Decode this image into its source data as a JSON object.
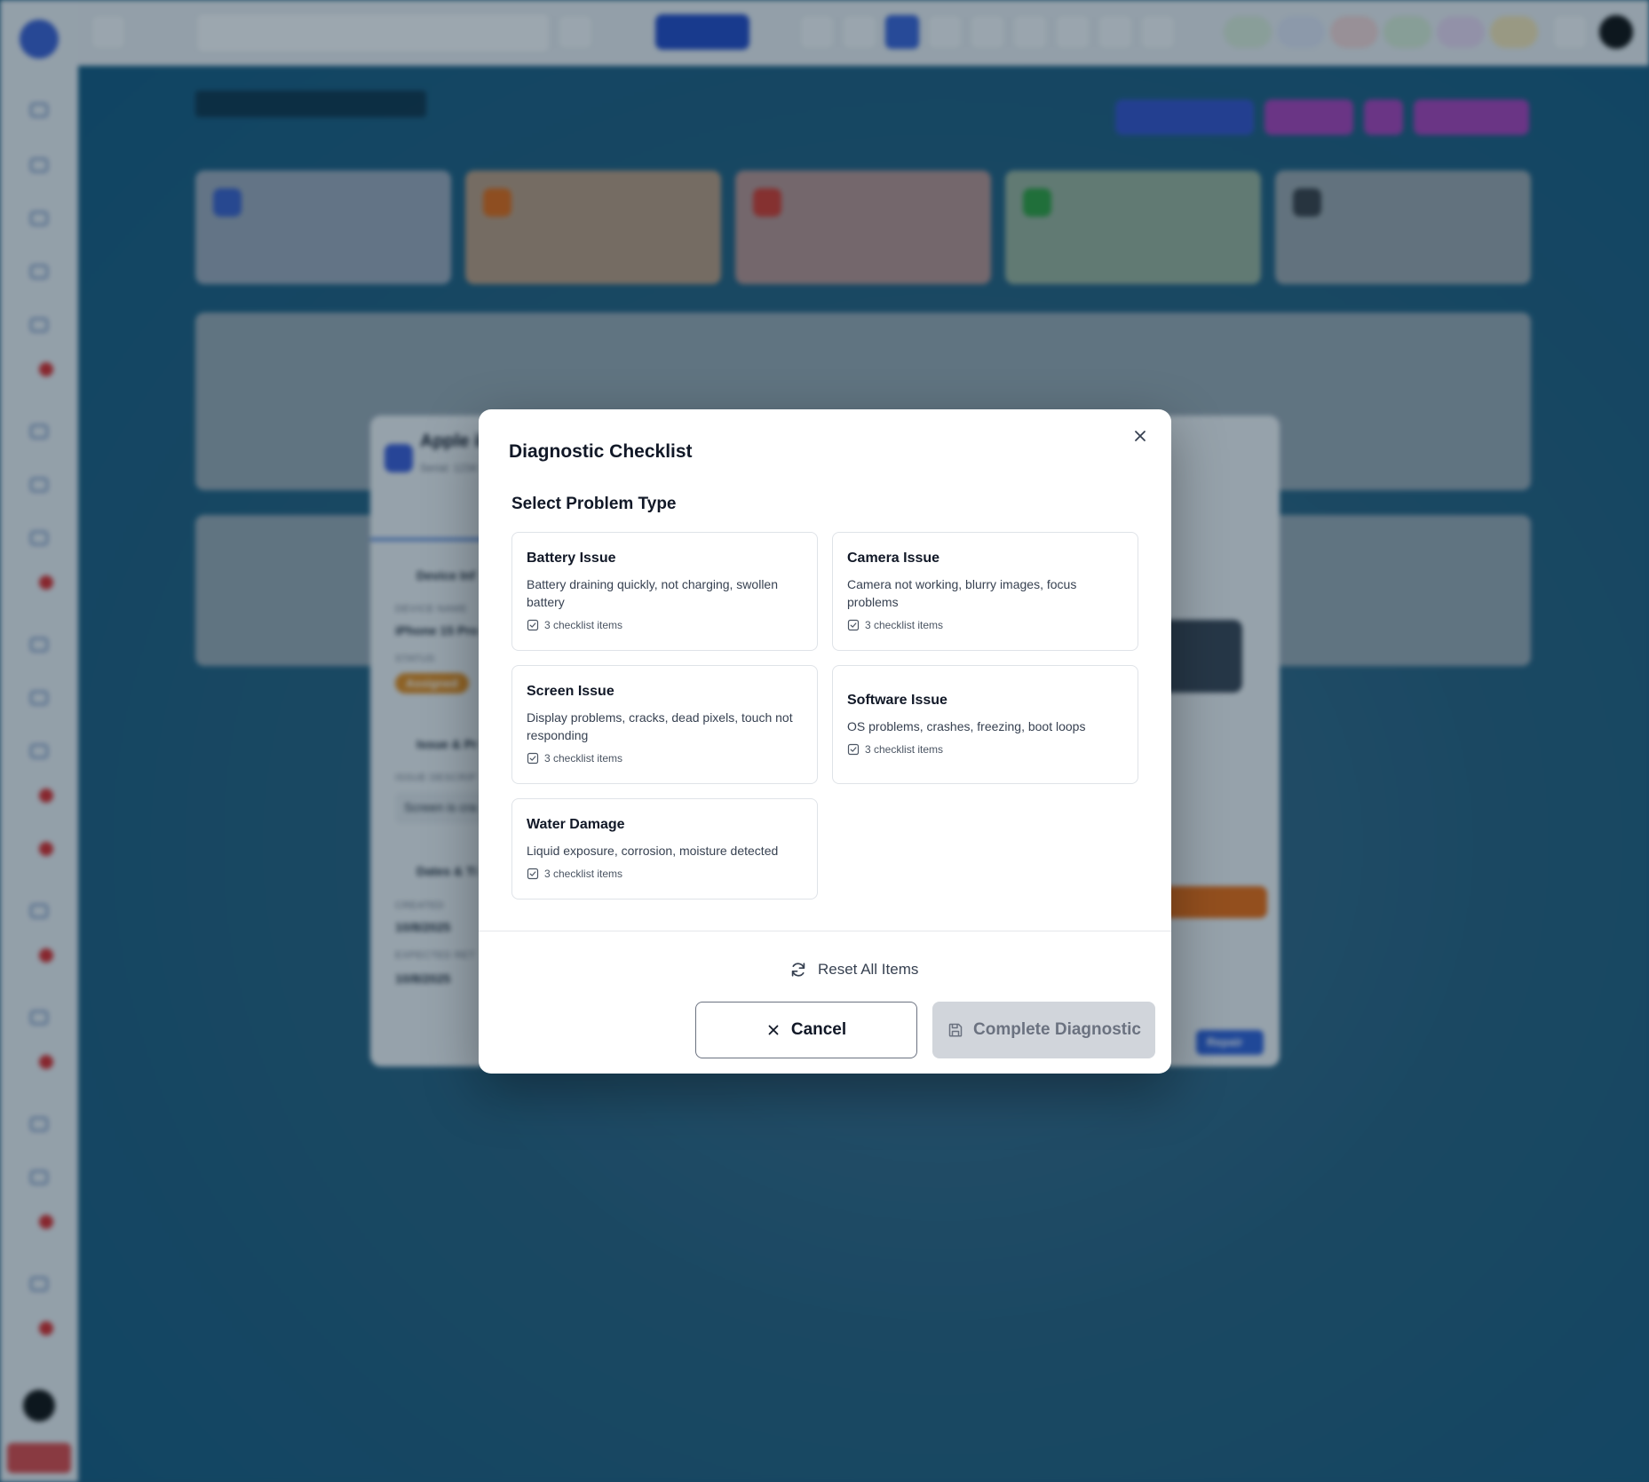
{
  "background": {
    "page_title": "Devices for Repair",
    "detail_modal": {
      "title": "Apple iP",
      "serial": "Serial: 1234",
      "device_info_label": "Device Inf",
      "device_name_label": "DEVICE NAME",
      "device_name_value": "iPhone 15 Pro",
      "status_label": "STATUS",
      "status_value": "Assigned",
      "issue_label": "Issue & Pr",
      "issue_desc_label": "ISSUE DESCRIP",
      "issue_desc_value": "Screen is cra",
      "dates_label": "Dates & Ti",
      "created_label": "CREATED",
      "created_value": "10/8/2025",
      "expected_label": "EXPECTED RET",
      "expected_value": "10/8/2025",
      "repair_button": "Repair"
    }
  },
  "modal": {
    "title": "Diagnostic Checklist",
    "section_title": "Select Problem Type",
    "problem_types": [
      {
        "title": "Battery Issue",
        "description": "Battery draining quickly, not charging, swollen battery",
        "items": "3 checklist items"
      },
      {
        "title": "Camera Issue",
        "description": "Camera not working, blurry images, focus problems",
        "items": "3 checklist items"
      },
      {
        "title": "Screen Issue",
        "description": "Display problems, cracks, dead pixels, touch not responding",
        "items": "3 checklist items"
      },
      {
        "title": "Software Issue",
        "description": "OS problems, crashes, freezing, boot loops",
        "items": "3 checklist items"
      },
      {
        "title": "Water Damage",
        "description": "Liquid exposure, corrosion, moisture detected",
        "items": "3 checklist items"
      }
    ],
    "reset_label": "Reset All Items",
    "cancel_label": "Cancel",
    "complete_label": "Complete Diagnostic"
  },
  "colors": {
    "accent": "#2349c4",
    "disabled_button": "#d1d5db",
    "status_assigned": "#e08a1e"
  },
  "icons": {
    "close": "close-icon",
    "checklist": "checkbox-icon",
    "reset": "refresh-icon",
    "cancel": "x-icon",
    "save": "save-icon"
  }
}
